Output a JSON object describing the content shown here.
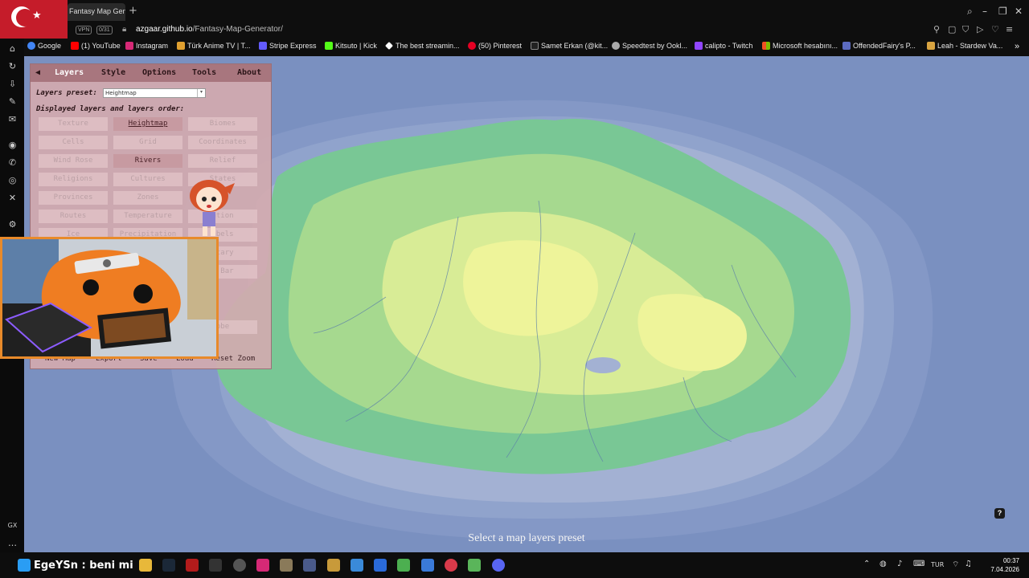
{
  "browser": {
    "tab_title": "Fantasy Map Gen",
    "new_tab": "+",
    "vpn_label": "VPN",
    "badge_label": "0/31",
    "url_domain": "azgaar.github.io",
    "url_path": "/Fantasy-Map-Generator/"
  },
  "bookmarks": [
    {
      "label": "Google",
      "color": "#4285f4"
    },
    {
      "label": "(1) YouTube",
      "color": "#ff0000"
    },
    {
      "label": "Instagram",
      "color": "#d62976"
    },
    {
      "label": "Türk Anime TV | T...",
      "color": "#e0a030"
    },
    {
      "label": "Stripe Express",
      "color": "#635bff"
    },
    {
      "label": "Kitsuto | Kick",
      "color": "#53fc18"
    },
    {
      "label": "The best streamin...",
      "color": "#ffffff"
    },
    {
      "label": "(50) Pinterest",
      "color": "#e60023"
    },
    {
      "label": "Samet Erkan (@kit...",
      "color": "#222222"
    },
    {
      "label": "Speedtest by Ookl...",
      "color": "#aaaaaa"
    },
    {
      "label": "calipto - Twitch",
      "color": "#9146ff"
    },
    {
      "label": "Microsoft hesabını...",
      "color": "#f25022"
    },
    {
      "label": "OffendedFairy's P...",
      "color": "#5c6bc0"
    },
    {
      "label": "Leah - Stardew Va...",
      "color": "#d9a441"
    }
  ],
  "panel": {
    "tabs": [
      "Layers",
      "Style",
      "Options",
      "Tools",
      "About"
    ],
    "back_glyph": "◀",
    "preset_label": "Layers preset:",
    "preset_value": "Heightmap",
    "order_label": "Displayed layers and layers order:",
    "layers": [
      [
        "Texture",
        "Heightmap",
        "Biomes"
      ],
      [
        "Cells",
        "Grid",
        "Coordinates"
      ],
      [
        "Wind Rose",
        "Rivers",
        "Relief"
      ],
      [
        "Religions",
        "Cultures",
        "States"
      ],
      [
        "Provinces",
        "Zones",
        ""
      ],
      [
        "Routes",
        "Temperature",
        "ation"
      ],
      [
        "Ice",
        "Precipitation",
        "abels"
      ],
      [
        "",
        "",
        "itary"
      ],
      [
        "",
        "",
        "e Bar"
      ],
      [
        "",
        "",
        ""
      ],
      [
        "",
        "",
        ""
      ],
      [
        "",
        "",
        "obe"
      ]
    ],
    "bottom_buttons": [
      "New Map",
      "Export",
      "Save",
      "Load",
      "Reset Zoom"
    ]
  },
  "map": {
    "caption": "Select a map layers preset",
    "help": "?"
  },
  "taskbar": {
    "nick": "EgeYSn : beni mi",
    "lang": "TUR",
    "time": "00:37",
    "date": "7.04.2026"
  },
  "colors": {
    "ocean": "#7a90c0",
    "land_low": "#79c795",
    "land_mid": "#aedb8f",
    "land_high": "#eef49a",
    "panel": "#d2aaaf",
    "accent": "#e88a2a"
  }
}
